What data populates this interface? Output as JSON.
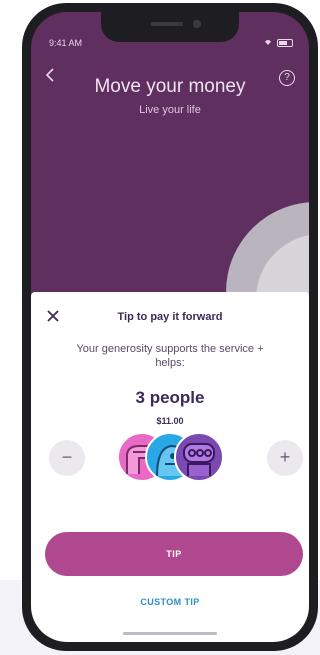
{
  "status_bar": {
    "time": "9:41 AM"
  },
  "header": {
    "title": "Move your money",
    "subtitle": "Live your life",
    "back_icon": "chevron-left-icon",
    "help_icon": "question-circle-icon",
    "help_glyph": "?"
  },
  "sheet": {
    "title": "Tip to pay it forward",
    "description": "Your generosity supports the service + helps:",
    "people_count": "3 people",
    "amount": "$11.00",
    "minus_label": "−",
    "plus_label": "+",
    "tip_button": "TIP",
    "custom_tip": "CUSTOM TIP"
  },
  "colors": {
    "background": "#5f2f5f",
    "accent": "#b0488f",
    "link": "#2a8fc8",
    "avatar_pink": "#e86ac6",
    "avatar_blue": "#2aa8e6",
    "avatar_purple": "#7b4ab0"
  }
}
